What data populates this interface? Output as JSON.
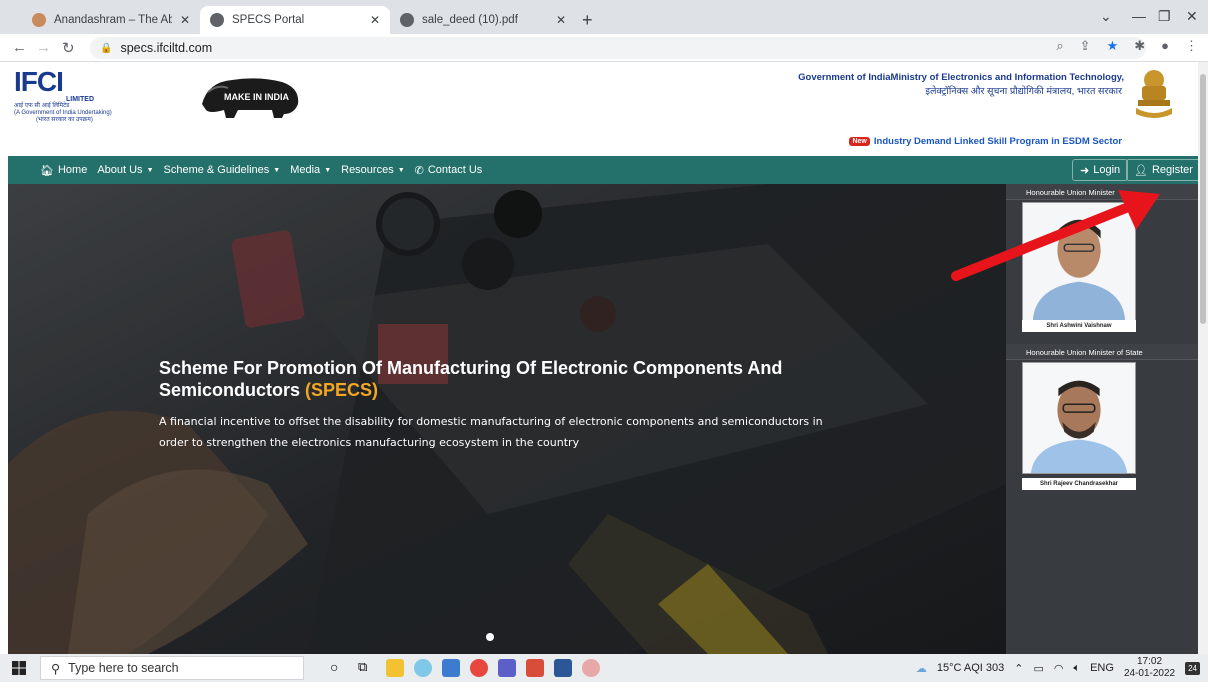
{
  "browser": {
    "tabs": [
      {
        "title": "Anandashram – The Abode Of Bl",
        "active": false
      },
      {
        "title": "SPECS Portal",
        "active": true
      },
      {
        "title": "sale_deed (10).pdf",
        "active": false
      }
    ],
    "url": "specs.ifciltd.com"
  },
  "header": {
    "ifci_logo": "IFCI",
    "ifci_limited": "LIMITED",
    "ifci_hindi": "आई एफ सी आई लिमिटेड",
    "ifci_govt": "(A Government of India Undertaking)",
    "ifci_govt_hi": "(भारत सरकार का उपक्रम)",
    "make_in_india": "MAKE IN INDIA",
    "gov_en": "Government of IndiaMinistry of Electronics and Information Technology,",
    "gov_hi": "इलेक्ट्रॉनिक्स और सूचना प्रौद्योगिकी मंत्रालय, भारत सरकार",
    "new_badge": "New",
    "ticker": "Industry Demand Linked Skill Program in ESDM Sector"
  },
  "nav": {
    "home": "Home",
    "about": "About Us",
    "scheme": "Scheme & Guidelines",
    "media": "Media",
    "resources": "Resources",
    "contact": "Contact Us",
    "login": "Login",
    "register": "Register"
  },
  "hero": {
    "title_main": "Scheme For Promotion Of Manufacturing Of Electronic Components And Semiconductors ",
    "title_accent": "(SPECS)",
    "description": "A financial incentive to offset the disability for domestic manufacturing of electronic components and semiconductors in order to strengthen the electronics manufacturing ecosystem in the country"
  },
  "sidebar": {
    "minister_heading": "Honourable Union Minister",
    "minister_name": "Shri Ashwini Vaishnaw",
    "mos_heading": "Honourable Union Minister of State",
    "mos_name": "Shri Rajeev Chandrasekhar"
  },
  "taskbar": {
    "search_placeholder": "Type here to search",
    "weather": "15°C  AQI 303",
    "lang": "ENG",
    "time": "17:02",
    "date": "24-01-2022",
    "notifications": "24"
  }
}
